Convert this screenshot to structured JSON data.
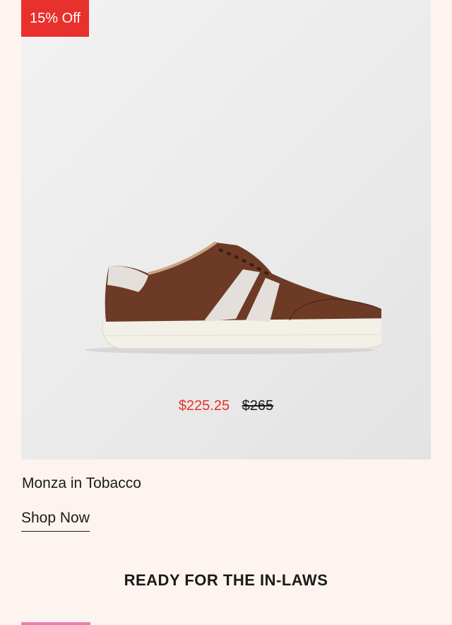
{
  "product": {
    "badge": "15% Off",
    "name": "Monza in Tobacco",
    "sale_price": "$225.25",
    "original_price": "$265",
    "cta_label": "Shop Now"
  },
  "section": {
    "heading": "READY FOR THE IN-LAWS"
  },
  "colors": {
    "badge_bg": "#e8302c",
    "sale_price": "#e8302c",
    "page_bg": "#fdf4ef",
    "shoe_leather": "#6b3a24",
    "shoe_suede": "#e4dfdb",
    "sole": "#f2efe8"
  }
}
